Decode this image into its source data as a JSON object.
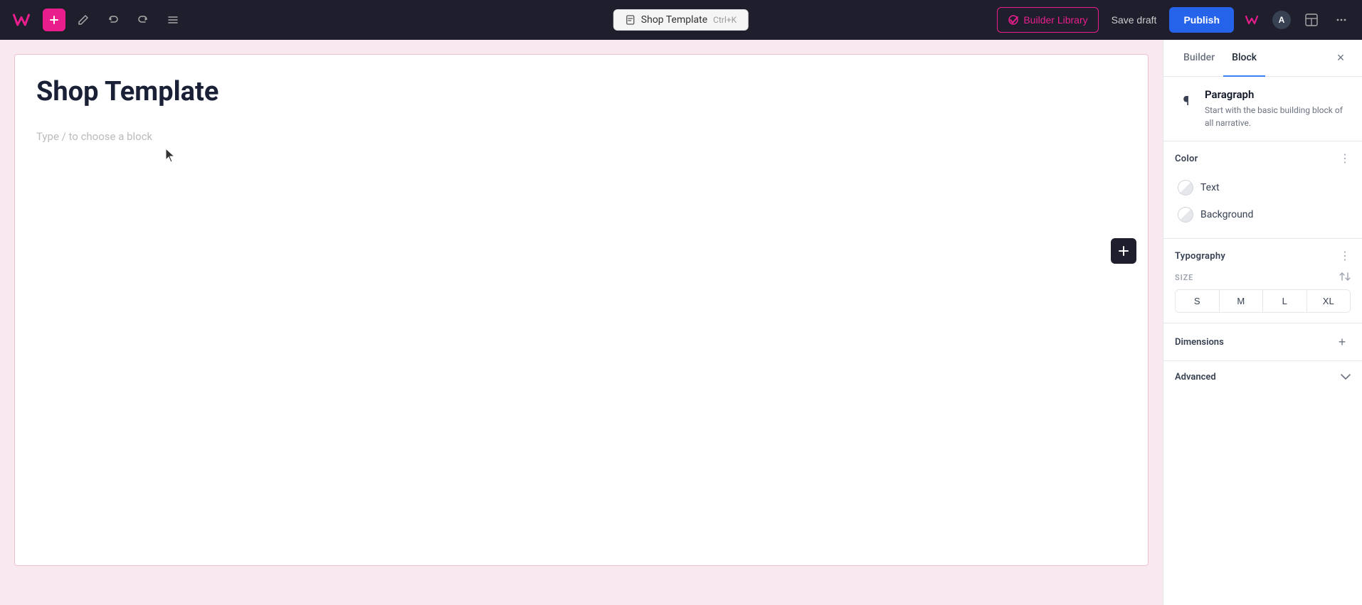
{
  "toolbar": {
    "logo_label": "W",
    "add_btn_label": "+",
    "edit_icon_label": "edit",
    "undo_icon_label": "undo",
    "redo_icon_label": "redo",
    "menu_icon_label": "menu",
    "file_tab": {
      "icon_label": "file",
      "title": "Shop Template",
      "shortcut": "Ctrl+K"
    },
    "builder_library_btn": "Builder Library",
    "save_draft_btn": "Save draft",
    "publish_btn": "Publish"
  },
  "canvas": {
    "title": "Shop Template",
    "placeholder": "Type / to choose a block"
  },
  "right_panel": {
    "tabs": [
      {
        "label": "Builder",
        "active": false
      },
      {
        "label": "Block",
        "active": true
      }
    ],
    "close_label": "×",
    "block_info": {
      "icon": "¶",
      "title": "Paragraph",
      "description": "Start with the basic building block of all narrative."
    },
    "color_section": {
      "title": "Color",
      "menu_icon": "⋮",
      "items": [
        {
          "label": "Text"
        },
        {
          "label": "Background"
        }
      ]
    },
    "typography_section": {
      "title": "Typography",
      "menu_icon": "⋮",
      "size_label": "SIZE",
      "size_adjust_icon": "⇄",
      "sizes": [
        "S",
        "M",
        "L",
        "XL"
      ]
    },
    "dimensions_section": {
      "title": "Dimensions",
      "add_icon": "+"
    },
    "advanced_section": {
      "title": "Advanced",
      "chevron": "∨"
    }
  }
}
